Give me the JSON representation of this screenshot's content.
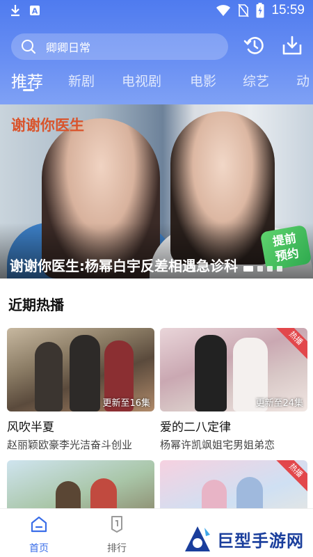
{
  "status_bar": {
    "time": "15:59",
    "icons": [
      "download-icon",
      "a-icon",
      "wifi-icon",
      "no-sim-icon",
      "battery-charging-icon"
    ]
  },
  "search": {
    "placeholder": "卿卿日常",
    "icon": "search-icon"
  },
  "header_actions": [
    "history-icon",
    "download-icon"
  ],
  "tabs": [
    {
      "label": "推荐",
      "active": true
    },
    {
      "label": "新剧",
      "active": false
    },
    {
      "label": "电视剧",
      "active": false
    },
    {
      "label": "电影",
      "active": false
    },
    {
      "label": "综艺",
      "active": false
    },
    {
      "label": "动",
      "active": false
    }
  ],
  "banner": {
    "logo_text": "谢谢你医生",
    "title": "谢谢你医生:杨幂白宇反差相遇急诊科",
    "badge": "提前\n预约",
    "slide_count": 4,
    "active_slide": 0
  },
  "section": {
    "title": "近期热播"
  },
  "cards": [
    {
      "title": "风吹半夏",
      "desc": "赵丽颖欧豪李光洁奋斗创业",
      "update": "更新至16集",
      "hot": ""
    },
    {
      "title": "爱的二八定律",
      "desc": "杨幂许凯飒姐宅男姐弟恋",
      "update": "更新至24集",
      "hot": "热播"
    },
    {
      "title": "",
      "desc": "",
      "update": "",
      "hot": ""
    },
    {
      "title": "",
      "desc": "",
      "update": "",
      "hot": "热播"
    }
  ],
  "bottom_nav": [
    {
      "label": "首页",
      "icon": "home-icon",
      "active": true
    },
    {
      "label": "排行",
      "icon": "ranking-icon",
      "active": false
    }
  ],
  "watermark": {
    "text": "巨型手游网"
  },
  "colors": {
    "header_top": "#4f7bef",
    "header_bottom": "#7fa1f5",
    "accent": "#3a6ee8",
    "hot_badge": "#e2474b",
    "banner_logo": "#d9542c"
  }
}
